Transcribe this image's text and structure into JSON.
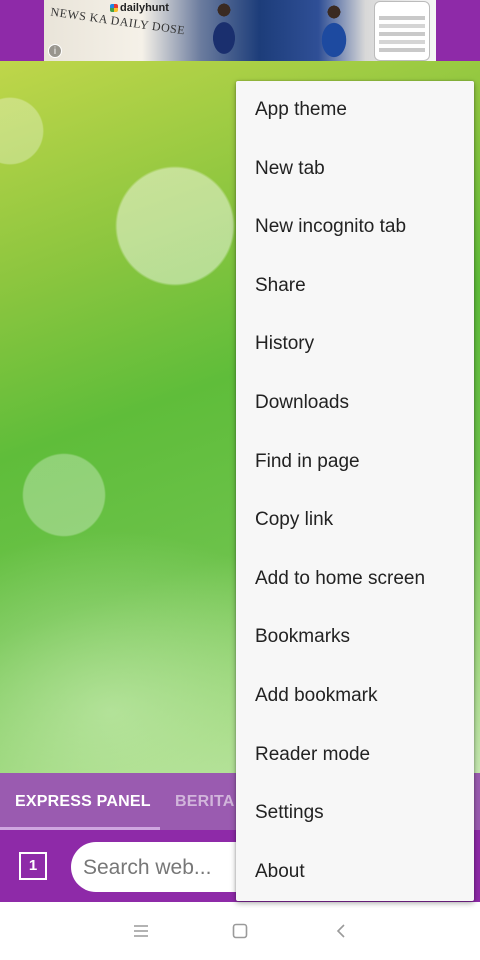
{
  "ad": {
    "newspaper_text": "NEWS KA DAILY DOSE",
    "brand": "dailyhunt"
  },
  "panel_tabs": [
    {
      "label": "EXPRESS PANEL",
      "selected": true
    },
    {
      "label": "BERITA",
      "selected": false
    }
  ],
  "toolbar": {
    "tab_count": "1",
    "search_placeholder": "Search web..."
  },
  "menu": {
    "items": [
      {
        "label": "App theme"
      },
      {
        "label": "New tab"
      },
      {
        "label": "New incognito tab"
      },
      {
        "label": "Share"
      },
      {
        "label": "History"
      },
      {
        "label": "Downloads"
      },
      {
        "label": "Find in page"
      },
      {
        "label": "Copy link"
      },
      {
        "label": "Add to home screen"
      },
      {
        "label": "Bookmarks"
      },
      {
        "label": "Add bookmark"
      },
      {
        "label": "Reader mode"
      },
      {
        "label": "Settings"
      },
      {
        "label": "About"
      }
    ]
  },
  "colors": {
    "toolbar": "#8e2aa8",
    "panel_tabs": "#9a5bb0",
    "menu_background": "#f7f7f7"
  },
  "icons": {
    "ad_info": "info-icon",
    "nav_menu": "menu-icon",
    "nav_home": "home-icon",
    "nav_back": "back-icon"
  }
}
